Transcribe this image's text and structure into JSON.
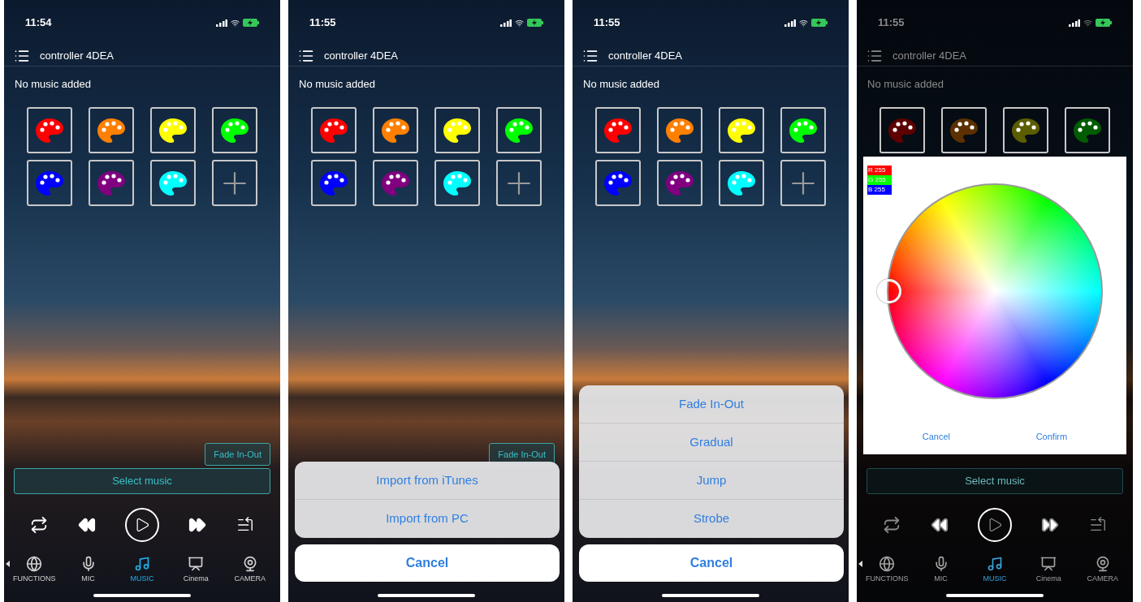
{
  "screens": [
    {
      "status_time": "11:54",
      "title": "controller 4DEA",
      "notice": "No music added",
      "tiles": [
        {
          "kind": "palette",
          "color": "#ff0000"
        },
        {
          "kind": "palette",
          "color": "#ff8000"
        },
        {
          "kind": "palette",
          "color": "#ffff00"
        },
        {
          "kind": "palette",
          "color": "#00ff00"
        },
        {
          "kind": "palette",
          "color": "#0000ff"
        },
        {
          "kind": "palette",
          "color": "#800080"
        },
        {
          "kind": "palette",
          "color": "#00ffff"
        },
        {
          "kind": "add"
        }
      ],
      "mode_button": "Fade In-Out",
      "select_button": "Select music",
      "player": true,
      "nav": [
        {
          "label": "FUNCTIONS",
          "selected": false
        },
        {
          "label": "MIC",
          "selected": false
        },
        {
          "label": "MUSIC",
          "selected": true
        },
        {
          "label": "Cinema",
          "selected": false
        },
        {
          "label": "CAMERA",
          "selected": false
        }
      ],
      "dimmed": false
    },
    {
      "status_time": "11:55",
      "title": "controller 4DEA",
      "notice": "No music added",
      "tiles": [
        {
          "kind": "palette",
          "color": "#ff0000"
        },
        {
          "kind": "palette",
          "color": "#ff8000"
        },
        {
          "kind": "palette",
          "color": "#ffff00"
        },
        {
          "kind": "palette",
          "color": "#00ff00"
        },
        {
          "kind": "palette",
          "color": "#0000ff"
        },
        {
          "kind": "palette",
          "color": "#800080"
        },
        {
          "kind": "palette",
          "color": "#00ffff"
        },
        {
          "kind": "add"
        }
      ],
      "mode_button": "Fade In-Out",
      "player": false,
      "dimmed": false,
      "overlay": {
        "kind": "action_sheet",
        "options": [
          "Import from iTunes",
          "Import from PC"
        ],
        "cancel": "Cancel"
      }
    },
    {
      "status_time": "11:55",
      "title": "controller 4DEA",
      "notice": "No music added",
      "tiles": [
        {
          "kind": "palette",
          "color": "#ff0000"
        },
        {
          "kind": "palette",
          "color": "#ff8000"
        },
        {
          "kind": "palette",
          "color": "#ffff00"
        },
        {
          "kind": "palette",
          "color": "#00ff00"
        },
        {
          "kind": "palette",
          "color": "#0000ff"
        },
        {
          "kind": "palette",
          "color": "#800080"
        },
        {
          "kind": "palette",
          "color": "#00ffff"
        },
        {
          "kind": "add"
        }
      ],
      "player": false,
      "dimmed": false,
      "overlay": {
        "kind": "action_sheet",
        "options": [
          "Fade In-Out",
          "Gradual",
          "Jump",
          "Strobe"
        ],
        "cancel": "Cancel"
      }
    },
    {
      "status_time": "11:55",
      "title": "controller 4DEA",
      "notice": "No music added",
      "tiles": [
        {
          "kind": "palette",
          "color": "#5c0000"
        },
        {
          "kind": "palette",
          "color": "#5c3000"
        },
        {
          "kind": "palette",
          "color": "#5c5c00"
        },
        {
          "kind": "palette",
          "color": "#005c00"
        }
      ],
      "select_button": "Select music",
      "player": true,
      "nav": [
        {
          "label": "FUNCTIONS",
          "selected": false
        },
        {
          "label": "MIC",
          "selected": false
        },
        {
          "label": "MUSIC",
          "selected": true
        },
        {
          "label": "Cinema",
          "selected": false
        },
        {
          "label": "CAMERA",
          "selected": false
        }
      ],
      "dimmed": true,
      "overlay": {
        "kind": "color_picker",
        "channels": [
          {
            "label": "R 255",
            "color": "#ff0000"
          },
          {
            "label": "G 255",
            "color": "#00ff00"
          },
          {
            "label": "B 255",
            "color": "#0000ff"
          }
        ],
        "cancel": "Cancel",
        "confirm": "Confirm"
      }
    }
  ]
}
